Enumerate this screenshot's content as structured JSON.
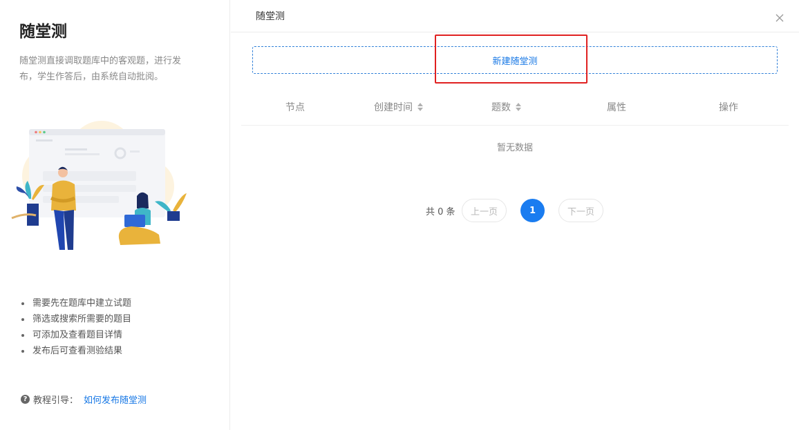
{
  "sidebar": {
    "title": "随堂测",
    "description": "随堂测直接调取题库中的客观题，进行发布，学生作答后，由系统自动批阅。",
    "tips": [
      "需要先在题库中建立试题",
      "筛选或搜索所需要的题目",
      "可添加及查看题目详情",
      "发布后可查看测验结果"
    ],
    "guide_label": "教程引导：",
    "guide_link": "如何发布随堂测"
  },
  "header": {
    "title": "随堂测",
    "close_icon": "close-icon"
  },
  "toolbar": {
    "new_button_label": "新建随堂测"
  },
  "table": {
    "columns": [
      {
        "label": "节点",
        "sortable": false
      },
      {
        "label": "创建时间",
        "sortable": true
      },
      {
        "label": "题数",
        "sortable": true
      },
      {
        "label": "属性",
        "sortable": false
      },
      {
        "label": "操作",
        "sortable": false
      }
    ],
    "empty_text": "暂无数据",
    "rows": []
  },
  "pagination": {
    "total_text": "共 0 条",
    "prev_label": "上一页",
    "current_page": "1",
    "next_label": "下一页"
  },
  "colors": {
    "accent": "#1677e5",
    "page_active": "#1a7cf0",
    "highlight_border": "#e02020"
  }
}
